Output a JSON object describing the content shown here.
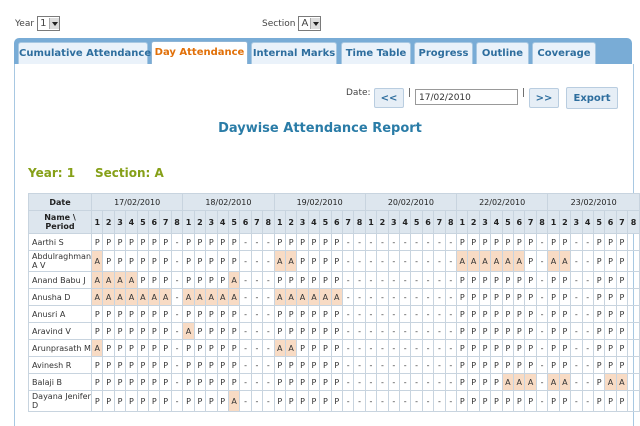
{
  "filters": {
    "year_label": "Year",
    "year_value": "1",
    "section_label": "Section",
    "section_value": "A"
  },
  "tabs": [
    {
      "label": "Cumulative Attendance",
      "active": false
    },
    {
      "label": "Day Attendance",
      "active": true
    },
    {
      "label": "Internal Marks",
      "active": false
    },
    {
      "label": "Time Table",
      "active": false
    },
    {
      "label": "Progress",
      "active": false
    },
    {
      "label": "Outline",
      "active": false
    },
    {
      "label": "Coverage",
      "active": false
    }
  ],
  "datebar": {
    "label": "Date:",
    "prev": "<<",
    "sep": "|",
    "value": "17/02/2010",
    "next": ">>",
    "export": "Export"
  },
  "report": {
    "title": "Daywise Attendance Report",
    "year_text": "Year: 1",
    "section_text": "Section: A"
  },
  "table": {
    "date_header": "Date",
    "name_header": "Name \\ Period",
    "dates": [
      "17/02/2010",
      "18/02/2010",
      "19/02/2010",
      "20/02/2010",
      "22/02/2010",
      "23/02/2010"
    ],
    "periods": [
      "1",
      "2",
      "3",
      "4",
      "5",
      "6",
      "7",
      "8"
    ],
    "rows": [
      {
        "name": "Aarthi S",
        "marks": [
          [
            "P",
            "P",
            "P",
            "P",
            "P",
            "P",
            "P",
            "-"
          ],
          [
            "P",
            "P",
            "P",
            "P",
            "P",
            "-",
            "-",
            "-"
          ],
          [
            "P",
            "P",
            "P",
            "P",
            "P",
            "P",
            "-",
            "-"
          ],
          [
            "-",
            "-",
            "-",
            "-",
            "-",
            "-",
            "-",
            "-"
          ],
          [
            "P",
            "P",
            "P",
            "P",
            "P",
            "P",
            "P",
            "-"
          ],
          [
            "P",
            "P",
            "-",
            "-",
            "P",
            "P",
            "P",
            ""
          ]
        ]
      },
      {
        "name": "Abdulraghman A V",
        "marks": [
          [
            "A",
            "P",
            "P",
            "P",
            "P",
            "P",
            "P",
            "-"
          ],
          [
            "P",
            "P",
            "P",
            "P",
            "P",
            "-",
            "-",
            "-"
          ],
          [
            "A",
            "A",
            "P",
            "P",
            "P",
            "P",
            "-",
            "-"
          ],
          [
            "-",
            "-",
            "-",
            "-",
            "-",
            "-",
            "-",
            "-"
          ],
          [
            "A",
            "A",
            "A",
            "A",
            "A",
            "A",
            "P",
            "-"
          ],
          [
            "A",
            "A",
            "-",
            "-",
            "P",
            "P",
            "P",
            ""
          ]
        ]
      },
      {
        "name": "Anand Babu J",
        "marks": [
          [
            "A",
            "A",
            "A",
            "A",
            "P",
            "P",
            "P",
            "-"
          ],
          [
            "P",
            "P",
            "P",
            "P",
            "A",
            "-",
            "-",
            "-"
          ],
          [
            "P",
            "P",
            "P",
            "P",
            "P",
            "P",
            "-",
            "-"
          ],
          [
            "-",
            "-",
            "-",
            "-",
            "-",
            "-",
            "-",
            "-"
          ],
          [
            "P",
            "P",
            "P",
            "P",
            "P",
            "P",
            "P",
            "-"
          ],
          [
            "P",
            "P",
            "-",
            "-",
            "P",
            "P",
            "P",
            ""
          ]
        ]
      },
      {
        "name": "Anusha D",
        "marks": [
          [
            "A",
            "A",
            "A",
            "A",
            "A",
            "A",
            "A",
            "-"
          ],
          [
            "A",
            "A",
            "A",
            "A",
            "A",
            "-",
            "-",
            "-"
          ],
          [
            "A",
            "A",
            "A",
            "A",
            "A",
            "A",
            "-",
            "-"
          ],
          [
            "-",
            "-",
            "-",
            "-",
            "-",
            "-",
            "-",
            "-"
          ],
          [
            "P",
            "P",
            "P",
            "P",
            "P",
            "P",
            "P",
            "-"
          ],
          [
            "P",
            "P",
            "-",
            "-",
            "P",
            "P",
            "P",
            ""
          ]
        ]
      },
      {
        "name": "Anusri A",
        "marks": [
          [
            "P",
            "P",
            "P",
            "P",
            "P",
            "P",
            "P",
            "-"
          ],
          [
            "P",
            "P",
            "P",
            "P",
            "P",
            "-",
            "-",
            "-"
          ],
          [
            "P",
            "P",
            "P",
            "P",
            "P",
            "P",
            "-",
            "-"
          ],
          [
            "-",
            "-",
            "-",
            "-",
            "-",
            "-",
            "-",
            "-"
          ],
          [
            "P",
            "P",
            "P",
            "P",
            "P",
            "P",
            "P",
            "-"
          ],
          [
            "P",
            "P",
            "-",
            "-",
            "P",
            "P",
            "P",
            ""
          ]
        ]
      },
      {
        "name": "Aravind V",
        "marks": [
          [
            "P",
            "P",
            "P",
            "P",
            "P",
            "P",
            "P",
            "-"
          ],
          [
            "A",
            "P",
            "P",
            "P",
            "P",
            "-",
            "-",
            "-"
          ],
          [
            "P",
            "P",
            "P",
            "P",
            "P",
            "P",
            "-",
            "-"
          ],
          [
            "-",
            "-",
            "-",
            "-",
            "-",
            "-",
            "-",
            "-"
          ],
          [
            "P",
            "P",
            "P",
            "P",
            "P",
            "P",
            "P",
            "-"
          ],
          [
            "P",
            "P",
            "-",
            "-",
            "P",
            "P",
            "P",
            ""
          ]
        ]
      },
      {
        "name": "Arunprasath M",
        "marks": [
          [
            "A",
            "P",
            "P",
            "P",
            "P",
            "P",
            "P",
            "-"
          ],
          [
            "P",
            "P",
            "P",
            "P",
            "P",
            "-",
            "-",
            "-"
          ],
          [
            "A",
            "A",
            "P",
            "P",
            "P",
            "P",
            "-",
            "-"
          ],
          [
            "-",
            "-",
            "-",
            "-",
            "-",
            "-",
            "-",
            "-"
          ],
          [
            "P",
            "P",
            "P",
            "P",
            "P",
            "P",
            "P",
            "-"
          ],
          [
            "P",
            "P",
            "-",
            "-",
            "P",
            "P",
            "P",
            ""
          ]
        ]
      },
      {
        "name": "Avinesh R",
        "marks": [
          [
            "P",
            "P",
            "P",
            "P",
            "P",
            "P",
            "P",
            "-"
          ],
          [
            "P",
            "P",
            "P",
            "P",
            "P",
            "-",
            "-",
            "-"
          ],
          [
            "P",
            "P",
            "P",
            "P",
            "P",
            "P",
            "-",
            "-"
          ],
          [
            "-",
            "-",
            "-",
            "-",
            "-",
            "-",
            "-",
            "-"
          ],
          [
            "P",
            "P",
            "P",
            "P",
            "P",
            "P",
            "P",
            "-"
          ],
          [
            "P",
            "P",
            "-",
            "-",
            "P",
            "P",
            "P",
            ""
          ]
        ]
      },
      {
        "name": "Balaji B",
        "marks": [
          [
            "P",
            "P",
            "P",
            "P",
            "P",
            "P",
            "P",
            "-"
          ],
          [
            "P",
            "P",
            "P",
            "P",
            "P",
            "-",
            "-",
            "-"
          ],
          [
            "P",
            "P",
            "P",
            "P",
            "P",
            "P",
            "-",
            "-"
          ],
          [
            "-",
            "-",
            "-",
            "-",
            "-",
            "-",
            "-",
            "-"
          ],
          [
            "P",
            "P",
            "P",
            "P",
            "A",
            "A",
            "A",
            "-"
          ],
          [
            "A",
            "A",
            "-",
            "-",
            "P",
            "A",
            "A",
            ""
          ]
        ]
      },
      {
        "name": "Dayana Jenifer D",
        "marks": [
          [
            "P",
            "P",
            "P",
            "P",
            "P",
            "P",
            "P",
            "-"
          ],
          [
            "P",
            "P",
            "P",
            "P",
            "A",
            "-",
            "-",
            "-"
          ],
          [
            "P",
            "P",
            "P",
            "P",
            "P",
            "P",
            "-",
            "-"
          ],
          [
            "-",
            "-",
            "-",
            "-",
            "-",
            "-",
            "-",
            "-"
          ],
          [
            "P",
            "P",
            "P",
            "P",
            "P",
            "P",
            "P",
            "-"
          ],
          [
            "P",
            "P",
            "-",
            "-",
            "P",
            "P",
            "P",
            ""
          ]
        ]
      }
    ]
  }
}
